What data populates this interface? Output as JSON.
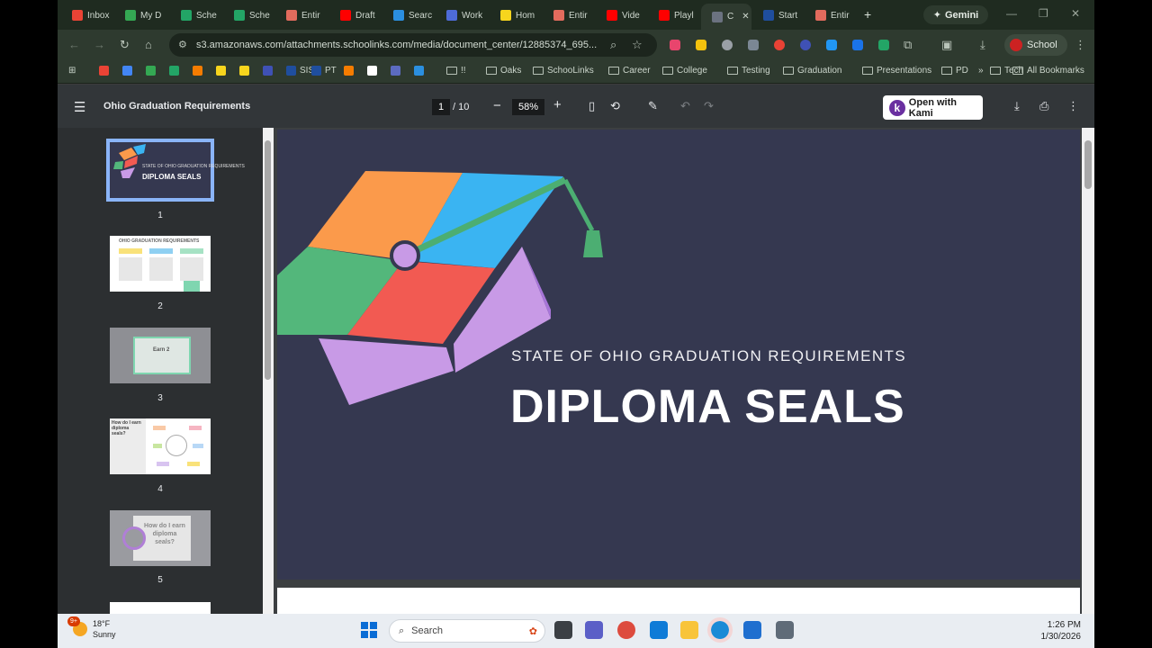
{
  "browser": {
    "tabs": [
      {
        "label": "Inbox",
        "color": "#ea4335"
      },
      {
        "label": "My D",
        "color": "#34a853"
      },
      {
        "label": "Sche",
        "color": "#23a566"
      },
      {
        "label": "Sche",
        "color": "#23a566"
      },
      {
        "label": "Entir",
        "color": "#e26b5d"
      },
      {
        "label": "Draft",
        "color": "#ff0000"
      },
      {
        "label": "Searc",
        "color": "#2b8fe0"
      },
      {
        "label": "Work",
        "color": "#4e6bd8"
      },
      {
        "label": "Hom",
        "color": "#f7d51d"
      },
      {
        "label": "Entir",
        "color": "#e26b5d"
      },
      {
        "label": "Vide",
        "color": "#ff0000"
      },
      {
        "label": "Playl",
        "color": "#ff0000"
      },
      {
        "label": "C",
        "color": "#6b7280"
      },
      {
        "label": "Start",
        "color": "#1f4e9e"
      },
      {
        "label": "Entir",
        "color": "#e26b5d"
      }
    ],
    "new_tab": "+",
    "gemini_label": "Gemini",
    "url": "s3.amazonaws.com/attachments.schoolinks.com/media/document_center/12885374_695...",
    "profile_label": "School",
    "bookmarks": [
      {
        "label": "",
        "kind": "apps"
      },
      {
        "label": "",
        "color": "#ea4335"
      },
      {
        "label": "",
        "color": "#4285f4"
      },
      {
        "label": "",
        "color": "#34a853"
      },
      {
        "label": "",
        "color": "#23a566"
      },
      {
        "label": "",
        "color": "#f57c00"
      },
      {
        "label": "",
        "color": "#f7d51d"
      },
      {
        "label": "",
        "color": "#f7d51d"
      },
      {
        "label": "",
        "color": "#3f51b5"
      },
      {
        "label": "SIS",
        "color": "#1f4e9e"
      },
      {
        "label": "PT",
        "color": "#1f4e9e"
      },
      {
        "label": "",
        "color": "#f57c00"
      },
      {
        "label": "",
        "color": "#ffffff"
      },
      {
        "label": "",
        "color": "#5c6bc0"
      },
      {
        "label": "",
        "color": "#2b8fe0"
      },
      {
        "label": "!!",
        "kind": "folder"
      },
      {
        "label": "Oaks",
        "kind": "folder"
      },
      {
        "label": "SchooLinks",
        "kind": "folder"
      },
      {
        "label": "Career",
        "kind": "folder"
      },
      {
        "label": "College",
        "kind": "folder"
      },
      {
        "label": "Testing",
        "kind": "folder"
      },
      {
        "label": "Graduation",
        "kind": "folder"
      },
      {
        "label": "Presentations",
        "kind": "folder"
      },
      {
        "label": "PD",
        "kind": "folder"
      },
      {
        "label": "Tech",
        "kind": "folder"
      }
    ],
    "more_bookmarks": "»",
    "all_bookmarks": "All Bookmarks"
  },
  "pdf": {
    "title": "Ohio Graduation Requirements",
    "current_page": "1",
    "total_pages": "/ 10",
    "zoom": "58%",
    "kami_label": "Open with Kami",
    "thumbnails": [
      {
        "num": "1",
        "title": "DIPLOMA SEALS"
      },
      {
        "num": "2",
        "title": "OHIO GRADUATION REQUIREMENTS"
      },
      {
        "num": "3",
        "title": "Earn 2"
      },
      {
        "num": "4",
        "title": "How do I earn diploma seals?"
      },
      {
        "num": "5",
        "title": "How do I earn diploma seals?"
      }
    ],
    "slide": {
      "subtitle": "STATE OF OHIO GRADUATION REQUIREMENTS",
      "title": "DIPLOMA SEALS",
      "colors": {
        "orange": "#fb9a4b",
        "blue": "#3ab4f2",
        "green": "#53b77b",
        "red": "#f25a52",
        "lavender": "#c89ae6",
        "purple_dark": "#a775d8",
        "bg": "#353850",
        "tassel": "#4cae72"
      }
    }
  },
  "taskbar": {
    "weather_temp": "18°F",
    "weather_desc": "Sunny",
    "weather_badge": "9+",
    "search_placeholder": "Search",
    "time": "1:26 PM",
    "date": "1/30/2026"
  }
}
